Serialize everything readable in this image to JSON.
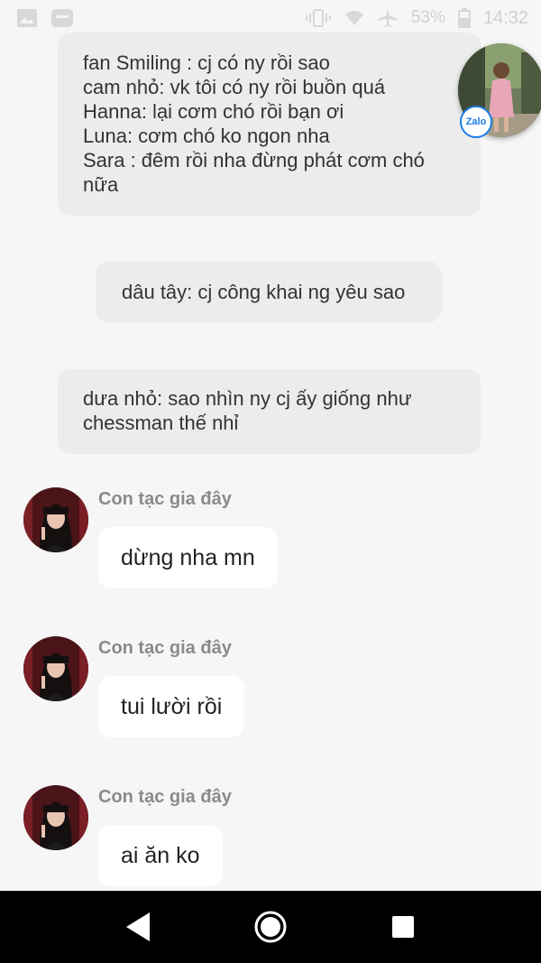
{
  "status_bar": {
    "battery": "53%",
    "time": "14:32"
  },
  "messages": {
    "forwarded_block_1": [
      "fan Smiling : cj có ny rồi sao",
      "cam nhỏ: vk tôi có ny rồi buồn quá",
      "Hanna: lại cơm chó rồi bạn ơi",
      "Luna: cơm chó ko ngon nha",
      "Sara : đêm rồi nha đừng phát cơm chó",
      "nữa"
    ],
    "forwarded_block_2": "dâu tây: cj công khai ng yêu sao",
    "forwarded_block_3": [
      "dưa nhỏ: sao nhìn ny cj ấy giống như",
      "chessman thế nhỉ"
    ]
  },
  "floating_bubble": {
    "badge": "Zalo"
  },
  "chat": [
    {
      "sender": "Con tạc gia đây",
      "text": "dừng nha mn"
    },
    {
      "sender": "Con tạc gia đây",
      "text": "tui lười rồi"
    },
    {
      "sender": "Con tạc gia đây",
      "text": "ai ăn ko"
    }
  ]
}
